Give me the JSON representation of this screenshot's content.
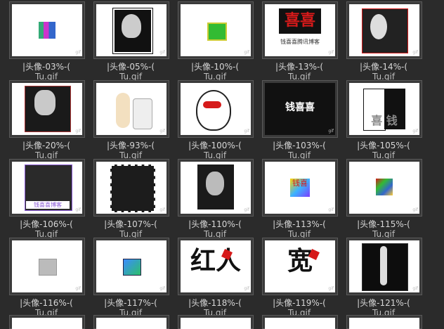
{
  "items": [
    {
      "caption": "|头像-03%-(",
      "sub": "Tu.gif"
    },
    {
      "caption": "|头像-05%-(",
      "sub": "Tu.gif"
    },
    {
      "caption": "|头像-10%-(",
      "sub": "Tu.gif"
    },
    {
      "caption": "|头像-13%-(",
      "sub": "Tu.gif"
    },
    {
      "caption": "|头像-14%-(",
      "sub": "Tu.gif"
    },
    {
      "caption": "|头像-20%-(",
      "sub": "Tu.gif"
    },
    {
      "caption": "|头像-93%-(",
      "sub": "Tu.gif"
    },
    {
      "caption": "|头像-100%-(",
      "sub": "Tu.gif"
    },
    {
      "caption": "|头像-103%-(",
      "sub": "Tu.gif"
    },
    {
      "caption": "|头像-105%-(",
      "sub": "Tu.gif"
    },
    {
      "caption": "|头像-106%-(",
      "sub": "Tu.gif"
    },
    {
      "caption": "|头像-107%-(",
      "sub": "Tu.gif"
    },
    {
      "caption": "|头像-110%-(",
      "sub": "Tu.gif"
    },
    {
      "caption": "|头像-113%-(",
      "sub": "Tu.gif"
    },
    {
      "caption": "|头像-115%-(",
      "sub": "Tu.gif"
    },
    {
      "caption": "|头像-116%-(",
      "sub": "Tu.gif"
    },
    {
      "caption": "|头像-117%-(",
      "sub": "Tu.gif"
    },
    {
      "caption": "|头像-118%-(",
      "sub": "Tu.gif"
    },
    {
      "caption": "|头像-119%-(",
      "sub": "Tu.gif"
    },
    {
      "caption": "|头像-121%-(",
      "sub": "Tu.gif"
    }
  ],
  "thumb_texts": {
    "t13": "喜喜",
    "t13b": "钱喜喜腾讯博客",
    "t103": "钱喜喜",
    "t105": "喜 钱",
    "t106": "钱喜喜博客",
    "t113": "钱喜",
    "t118": "红人",
    "t119": "宽"
  },
  "badge": "gif",
  "colors": {
    "bg": "#2b2b2b",
    "frame": "#3a3a3a",
    "border": "#5a5a5a",
    "caption": "#d7d7d7",
    "red": "#d61a1a"
  }
}
